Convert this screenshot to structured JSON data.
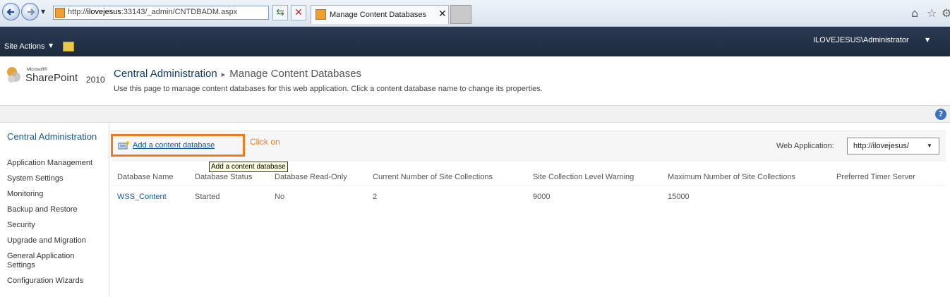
{
  "browser": {
    "url_prefix": "http://",
    "url_host": "ilovejesus",
    "url_rest": ":33143/_admin/CNTDBADM.aspx",
    "tab_title": "Manage Content Databases"
  },
  "topbar": {
    "site_actions": "Site Actions",
    "user": "ILOVEJESUS\\Administrator"
  },
  "logo": {
    "microsoft": "Microsoft®",
    "product": "SharePoint",
    "version": "2010"
  },
  "title": {
    "breadcrumb_root": "Central Administration",
    "breadcrumb_sep": "▸",
    "page": "Manage Content Databases",
    "description": "Use this page to manage content databases for this web application. Click a content database name to change its properties."
  },
  "nav": {
    "header": "Central Administration",
    "items": [
      "Application Management",
      "System Settings",
      "Monitoring",
      "Backup and Restore",
      "Security",
      "Upgrade and Migration",
      "General Application Settings",
      "Configuration Wizards"
    ]
  },
  "toolbar": {
    "add_label": "Add a content database",
    "tooltip": "Add a content database",
    "annotation": "Click on",
    "webapp_label": "Web Application:",
    "webapp_value": "http://ilovejesus/"
  },
  "table": {
    "headers": [
      "Database Name",
      "Database Status",
      "Database Read-Only",
      "Current Number of Site Collections",
      "Site Collection Level Warning",
      "Maximum Number of Site Collections",
      "Preferred Timer Server"
    ],
    "rows": [
      [
        "WSS_Content",
        "Started",
        "No",
        "2",
        "9000",
        "15000",
        ""
      ]
    ]
  },
  "colors": {
    "accent_orange": "#f07b1c",
    "ribbon_dark": "#1c2a3e",
    "link_blue": "#0f5a9b"
  }
}
